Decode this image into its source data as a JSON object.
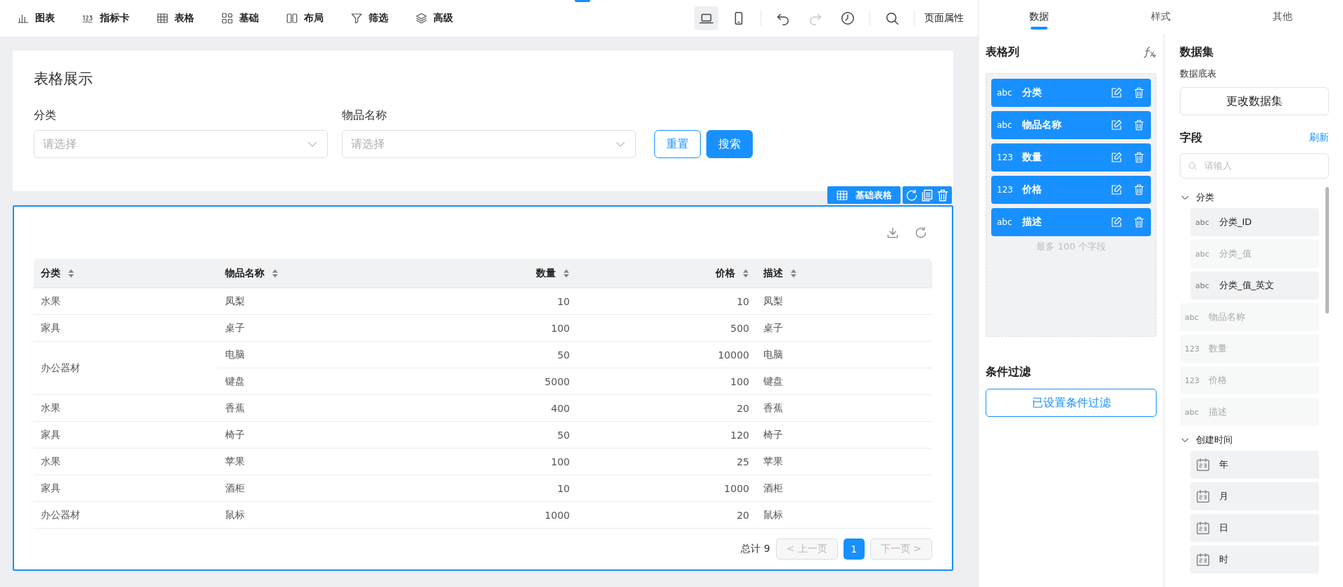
{
  "toolbar": {
    "items": [
      {
        "label": "图表"
      },
      {
        "label": "指标卡"
      },
      {
        "label": "表格"
      },
      {
        "label": "基础"
      },
      {
        "label": "布局"
      },
      {
        "label": "筛选"
      },
      {
        "label": "高级"
      }
    ],
    "devices": [
      {
        "kind": "laptop",
        "selected": true
      },
      {
        "kind": "phone",
        "selected": false
      }
    ],
    "actions": [
      {
        "kind": "undo",
        "disabled": false
      },
      {
        "kind": "redo",
        "disabled": true
      },
      {
        "kind": "history",
        "disabled": false
      },
      {
        "kind": "search",
        "disabled": false
      }
    ],
    "page_settings": "页面属性"
  },
  "filter_card": {
    "title": "表格展示",
    "fields": [
      {
        "label": "分类",
        "placeholder": "请选择"
      },
      {
        "label": "物品名称",
        "placeholder": "请选择"
      }
    ],
    "reset": "重置",
    "search": "搜索"
  },
  "table_widget": {
    "badge": "基础表格",
    "columns": [
      "分类",
      "物品名称",
      "数量",
      "价格",
      "描述"
    ],
    "groups": [
      {
        "category": "水果",
        "items": [
          {
            "name": "凤梨",
            "qty": "10",
            "price": "10",
            "desc": "凤梨"
          }
        ]
      },
      {
        "category": "家具",
        "items": [
          {
            "name": "桌子",
            "qty": "100",
            "price": "500",
            "desc": "桌子"
          }
        ]
      },
      {
        "category": "办公器材",
        "items": [
          {
            "name": "电脑",
            "qty": "50",
            "price": "10000",
            "desc": "电脑"
          },
          {
            "name": "键盘",
            "qty": "5000",
            "price": "100",
            "desc": "键盘"
          }
        ]
      },
      {
        "category": "水果",
        "items": [
          {
            "name": "香蕉",
            "qty": "400",
            "price": "20",
            "desc": "香蕉"
          }
        ]
      },
      {
        "category": "家具",
        "items": [
          {
            "name": "椅子",
            "qty": "50",
            "price": "120",
            "desc": "椅子"
          }
        ]
      },
      {
        "category": "水果",
        "items": [
          {
            "name": "苹果",
            "qty": "100",
            "price": "25",
            "desc": "苹果"
          }
        ]
      },
      {
        "category": "家具",
        "items": [
          {
            "name": "酒柜",
            "qty": "10",
            "price": "1000",
            "desc": "酒柜"
          }
        ]
      },
      {
        "category": "办公器材",
        "items": [
          {
            "name": "鼠标",
            "qty": "1000",
            "price": "20",
            "desc": "鼠标"
          }
        ]
      }
    ],
    "pagination": {
      "total": "总计 9",
      "prev": "< 上一页",
      "next": "下一页 >",
      "pages": [
        {
          "label": "1",
          "selected": true
        }
      ]
    }
  },
  "side_panel": {
    "tabs": [
      {
        "label": "数据",
        "selected": true
      },
      {
        "label": "样式",
        "selected": false
      },
      {
        "label": "其他",
        "selected": false
      }
    ],
    "table_columns": {
      "title": "表格列",
      "items": [
        {
          "type_label": "abc",
          "label": "分类"
        },
        {
          "type_label": "abc",
          "label": "物品名称"
        },
        {
          "type_label": "123",
          "label": "数量"
        },
        {
          "type_label": "123",
          "label": "价格"
        },
        {
          "type_label": "abc",
          "label": "描述"
        }
      ],
      "note": "最多 100 个字段"
    },
    "condition_filter": {
      "title": "条件过滤",
      "button": "已设置条件过滤"
    },
    "dataset": {
      "title": "数据集",
      "subtitle": "数据底表",
      "button": "更改数据集"
    },
    "fields": {
      "title": "字段",
      "refresh": "刷新",
      "search_placeholder": "请输入",
      "tree": [
        {
          "kind": "group",
          "label": "分类",
          "expanded": true,
          "children": [
            {
              "kind": "field",
              "type_label": "abc",
              "label": "分类_ID",
              "disabled": false
            },
            {
              "kind": "field",
              "type_label": "abc",
              "label": "分类_值",
              "disabled": true
            },
            {
              "kind": "field",
              "type_label": "abc",
              "label": "分类_值_英文",
              "disabled": false
            }
          ]
        },
        {
          "kind": "field",
          "type_label": "abc",
          "label": "物品名称",
          "disabled": true
        },
        {
          "kind": "field",
          "type_label": "123",
          "label": "数量",
          "disabled": true
        },
        {
          "kind": "field",
          "type_label": "123",
          "label": "价格",
          "disabled": true
        },
        {
          "kind": "field",
          "type_label": "abc",
          "label": "描述",
          "disabled": true
        },
        {
          "kind": "group",
          "label": "创建时间",
          "expanded": true,
          "children": [
            {
              "kind": "date",
              "label": "年",
              "disabled": false
            },
            {
              "kind": "date",
              "label": "月",
              "disabled": false
            },
            {
              "kind": "date",
              "label": "日",
              "disabled": false
            },
            {
              "kind": "date",
              "label": "时",
              "disabled": false
            }
          ]
        }
      ]
    }
  }
}
